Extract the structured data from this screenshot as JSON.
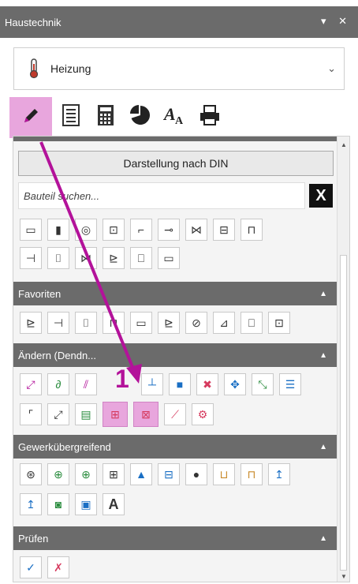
{
  "window": {
    "title": "Haustechnik",
    "controls": "▾ ✕"
  },
  "category": {
    "selected": "Heizung"
  },
  "tabs": [
    {
      "name": "edit"
    },
    {
      "name": "list"
    },
    {
      "name": "calculator"
    },
    {
      "name": "pie-chart"
    },
    {
      "name": "font"
    },
    {
      "name": "print"
    }
  ],
  "panel": {
    "din_button": "Darstellung nach DIN",
    "search_placeholder": "Bauteil suchen...",
    "clear_label": "X"
  },
  "sections": {
    "favoriten": "Favoriten",
    "aendern": "Ändern (Dendn...",
    "gewerk": "Gewerkübergreifend",
    "pruefen": "Prüfen"
  },
  "annotation": {
    "number": "1",
    "color": "#b3129a"
  },
  "colors": {
    "accent": "#e8a6dd",
    "header": "#6b6b6b",
    "arrow": "#b3129a"
  }
}
